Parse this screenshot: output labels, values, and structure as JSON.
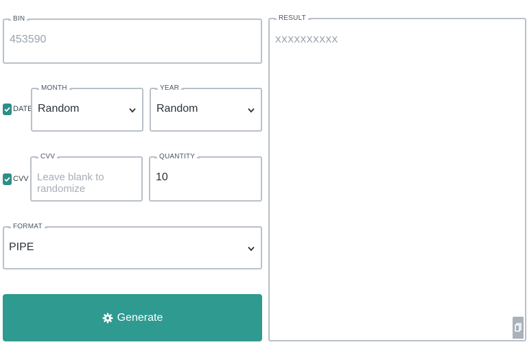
{
  "bin": {
    "label": "BIN",
    "value": "453590"
  },
  "date": {
    "label": "DATE",
    "checked": true
  },
  "month": {
    "label": "MONTH",
    "value": "Random"
  },
  "year": {
    "label": "YEAR",
    "value": "Random"
  },
  "cvv_toggle": {
    "label": "CVV",
    "checked": true
  },
  "cvv": {
    "label": "CVV",
    "placeholder": "Leave blank to randomize"
  },
  "quantity": {
    "label": "QUANTITY",
    "value": "10"
  },
  "format": {
    "label": "FORMAT",
    "value": "PIPE"
  },
  "generate": {
    "label": "Generate",
    "icon": "gear-icon"
  },
  "result": {
    "label": "RESULT",
    "value": "XXXXXXXXXX",
    "copy_icon": "copy-icon"
  },
  "colors": {
    "accent": "#2e9a90",
    "border": "#b9c0c7"
  }
}
